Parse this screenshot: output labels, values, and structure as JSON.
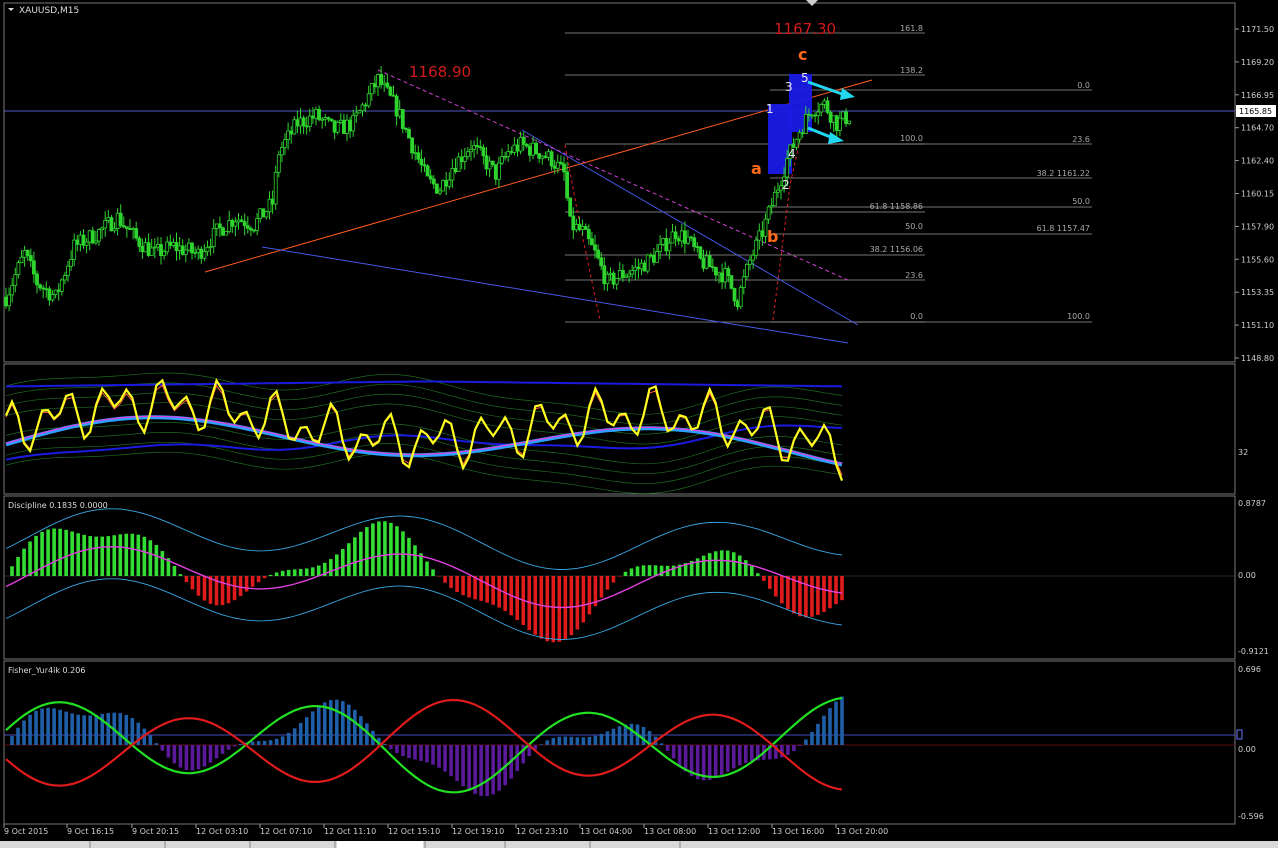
{
  "colors": {
    "background": "#000000",
    "grid": "#4a4a4a",
    "bull_candle": "#2fd42f",
    "bear_candle": "#2fd42f",
    "fib": "#aaaaaa",
    "trend_orange": "#ff5a1e",
    "trend_blue": "#3b4fd6",
    "trend_magenta": "#d040d0",
    "wave_label": "#ff6a1a",
    "arrow": "#22d8f0",
    "hist_up": "#33dd33",
    "hist_down": "#e01b1b",
    "fisher_green": "#22e022",
    "fisher_red": "#e01b1b",
    "fisher_up": "#1f5fa8",
    "fisher_down": "#5a1a9a",
    "yellow": "#ffff22"
  },
  "price_panel": {
    "title": "XAUUSD,M15",
    "current_price": "1165.85",
    "price_labels": [
      {
        "text": "1168.90",
        "type": "red"
      },
      {
        "text": "1167.30",
        "type": "red"
      }
    ],
    "fib_labels": [
      "161.8",
      "138.2",
      "100.0",
      "0.0",
      "23.6",
      "38.2 1161.22",
      "61.8 1158.86",
      "50.0",
      "50.0",
      "61.8 1157.47",
      "38.2 1156.06",
      "23.6",
      "0.0",
      "100.0"
    ],
    "wave_labels_orange": [
      "a",
      "b",
      "c"
    ],
    "wave_labels_white": [
      "1",
      "2",
      "3",
      "4",
      "5"
    ]
  },
  "osc1_panel": {
    "title": "",
    "level_label": "32"
  },
  "osc2_panel": {
    "title": "Discipline 0.1835 0.0000",
    "scale": [
      "0.8787",
      "0.00",
      "-0.9121"
    ]
  },
  "osc3_panel": {
    "title": "Fisher_Yur4ik 0.206",
    "scale": [
      "0.696",
      "0.00",
      "-0.596"
    ]
  },
  "time_axis": [
    "9 Oct 2015",
    "9 Oct 16:15",
    "9 Oct 20:15",
    "12 Oct 03:10",
    "12 Oct 07:10",
    "12 Oct 11:10",
    "12 Oct 15:10",
    "12 Oct 19:10",
    "12 Oct 23:10",
    "13 Oct 04:00",
    "13 Oct 08:00",
    "13 Oct 12:00",
    "13 Oct 16:00",
    "13 Oct 20:00"
  ],
  "chart_data": {
    "type": "candlestick",
    "title": "XAUUSD,M15",
    "y_ticks": [
      "1171.50",
      "1169.20",
      "1166.95",
      "1164.70",
      "1162.40",
      "1160.15",
      "1157.90",
      "1155.60",
      "1153.35",
      "1151.10",
      "1148.80"
    ],
    "ylim": [
      1148.8,
      1172.6
    ],
    "x_labels": [
      "9 Oct 2015",
      "9 Oct 16:15",
      "9 Oct 20:15",
      "12 Oct 03:10",
      "12 Oct 07:10",
      "12 Oct 11:10",
      "12 Oct 15:10",
      "12 Oct 19:10",
      "12 Oct 23:10",
      "13 Oct 04:00",
      "13 Oct 08:00",
      "13 Oct 12:00",
      "13 Oct 16:00",
      "13 Oct 20:00"
    ],
    "close_path": [
      [
        0,
        1153.0
      ],
      [
        3,
        1156.0
      ],
      [
        5,
        1154.0
      ],
      [
        8,
        1153.0
      ],
      [
        11,
        1156.5
      ],
      [
        15,
        1157.5
      ],
      [
        18,
        1158.5
      ],
      [
        21,
        1157.0
      ],
      [
        24,
        1156.0
      ],
      [
        27,
        1156.5
      ],
      [
        31,
        1156.0
      ],
      [
        34,
        1157.5
      ],
      [
        37,
        1158.5
      ],
      [
        40,
        1158.0
      ],
      [
        43,
        1159.5
      ],
      [
        44,
        1163.0
      ],
      [
        47,
        1165.0
      ],
      [
        50,
        1165.5
      ],
      [
        53,
        1164.5
      ],
      [
        56,
        1165.0
      ],
      [
        58,
        1166.5
      ],
      [
        60,
        1168.0
      ],
      [
        63,
        1166.0
      ],
      [
        66,
        1163.0
      ],
      [
        68,
        1161.0
      ],
      [
        70,
        1160.5
      ],
      [
        72,
        1162.0
      ],
      [
        75,
        1163.5
      ],
      [
        77,
        1162.5
      ],
      [
        79,
        1161.5
      ],
      [
        81,
        1163.0
      ],
      [
        83,
        1163.5
      ],
      [
        86,
        1163.0
      ],
      [
        88,
        1162.5
      ],
      [
        90,
        1161.5
      ],
      [
        91,
        1158.0
      ],
      [
        93,
        1157.5
      ],
      [
        95,
        1156.0
      ],
      [
        97,
        1154.0
      ],
      [
        99,
        1154.5
      ],
      [
        102,
        1155.0
      ],
      [
        105,
        1156.0
      ],
      [
        108,
        1157.5
      ],
      [
        110,
        1157.0
      ],
      [
        112,
        1155.5
      ],
      [
        114,
        1155.0
      ],
      [
        116,
        1154.5
      ],
      [
        118,
        1152.8
      ],
      [
        120,
        1155.5
      ],
      [
        122,
        1157.5
      ],
      [
        124,
        1160.0
      ],
      [
        126,
        1162.5
      ],
      [
        128,
        1164.5
      ],
      [
        130,
        1166.0
      ],
      [
        132,
        1166.3
      ],
      [
        134,
        1165.0
      ],
      [
        136,
        1165.5
      ]
    ]
  }
}
